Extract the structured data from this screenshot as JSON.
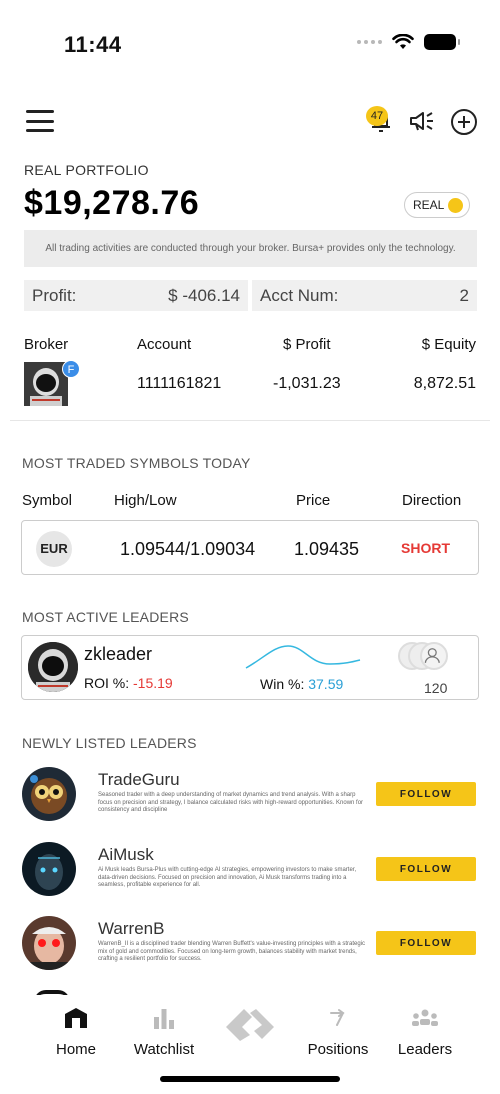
{
  "status_bar": {
    "time": "11:44"
  },
  "header": {
    "notification_count": "47"
  },
  "portfolio": {
    "label": "REAL PORTFOLIO",
    "value": "$19,278.76",
    "toggle_label": "REAL",
    "disclaimer": "All trading activities are conducted through your broker. Bursa+ provides only the technology.",
    "profit_label": "Profit:",
    "profit_value": "$ -406.14",
    "acct_label": "Acct Num:",
    "acct_value": "2"
  },
  "broker_table": {
    "headers": {
      "broker": "Broker",
      "account": "Account",
      "profit": "$ Profit",
      "equity": "$ Equity"
    },
    "row": {
      "badge": "F",
      "account": "1111161821",
      "profit": "-1,031.23",
      "equity": "8,872.51"
    }
  },
  "most_traded": {
    "title": "MOST TRADED SYMBOLS TODAY",
    "headers": {
      "symbol": "Symbol",
      "high_low": "High/Low",
      "price": "Price",
      "direction": "Direction"
    },
    "row": {
      "symbol": "EUR",
      "high_low": "1.09544/1.09034",
      "price": "1.09435",
      "direction": "SHORT"
    }
  },
  "most_active": {
    "title": "MOST ACTIVE LEADERS",
    "leader": {
      "name": "zkleader",
      "roi_label": "ROI %:",
      "roi_value": "-15.19",
      "win_label": "Win %:",
      "win_value": "37.59",
      "followers": "120"
    }
  },
  "newly_listed": {
    "title": "NEWLY LISTED LEADERS",
    "follow_label": "FOLLOW",
    "leaders": [
      {
        "name": "TradeGuru",
        "desc": "Seasoned trader with a deep understanding of market dynamics and trend analysis. With a sharp focus on precision and strategy, I balance calculated risks with high-reward opportunities. Known for consistency and discipline"
      },
      {
        "name": "AiMusk",
        "desc": "Ai Musk leads Bursa-Plus with cutting-edge AI strategies, empowering investors to make smarter, data-driven decisions. Focused on precision and innovation, Ai Musk transforms trading into a seamless, profitable experience for all."
      },
      {
        "name": "WarrenB",
        "desc": "WarrenB_II is a disciplined trader blending Warren Buffett's value-investing principles with a strategic mix of gold and commodities. Focused on long-term growth, balances stability with market trends, crafting a resilient portfolio for success."
      }
    ]
  },
  "nav": {
    "home": "Home",
    "watchlist": "Watchlist",
    "positions": "Positions",
    "leaders": "Leaders"
  },
  "colors": {
    "accent": "#f5c518",
    "negative": "#e53935",
    "positive": "#2a9fd6"
  }
}
